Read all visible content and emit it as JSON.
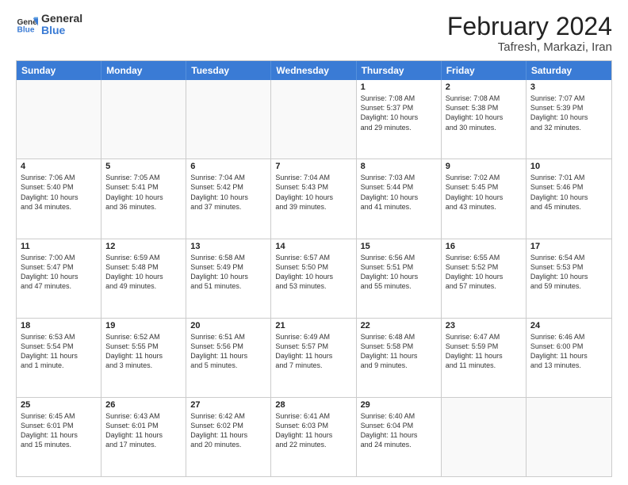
{
  "logo": {
    "line1": "General",
    "line2": "Blue"
  },
  "title": {
    "month_year": "February 2024",
    "location": "Tafresh, Markazi, Iran"
  },
  "header_days": [
    "Sunday",
    "Monday",
    "Tuesday",
    "Wednesday",
    "Thursday",
    "Friday",
    "Saturday"
  ],
  "rows": [
    [
      {
        "day": "",
        "info": ""
      },
      {
        "day": "",
        "info": ""
      },
      {
        "day": "",
        "info": ""
      },
      {
        "day": "",
        "info": ""
      },
      {
        "day": "1",
        "info": "Sunrise: 7:08 AM\nSunset: 5:37 PM\nDaylight: 10 hours\nand 29 minutes."
      },
      {
        "day": "2",
        "info": "Sunrise: 7:08 AM\nSunset: 5:38 PM\nDaylight: 10 hours\nand 30 minutes."
      },
      {
        "day": "3",
        "info": "Sunrise: 7:07 AM\nSunset: 5:39 PM\nDaylight: 10 hours\nand 32 minutes."
      }
    ],
    [
      {
        "day": "4",
        "info": "Sunrise: 7:06 AM\nSunset: 5:40 PM\nDaylight: 10 hours\nand 34 minutes."
      },
      {
        "day": "5",
        "info": "Sunrise: 7:05 AM\nSunset: 5:41 PM\nDaylight: 10 hours\nand 36 minutes."
      },
      {
        "day": "6",
        "info": "Sunrise: 7:04 AM\nSunset: 5:42 PM\nDaylight: 10 hours\nand 37 minutes."
      },
      {
        "day": "7",
        "info": "Sunrise: 7:04 AM\nSunset: 5:43 PM\nDaylight: 10 hours\nand 39 minutes."
      },
      {
        "day": "8",
        "info": "Sunrise: 7:03 AM\nSunset: 5:44 PM\nDaylight: 10 hours\nand 41 minutes."
      },
      {
        "day": "9",
        "info": "Sunrise: 7:02 AM\nSunset: 5:45 PM\nDaylight: 10 hours\nand 43 minutes."
      },
      {
        "day": "10",
        "info": "Sunrise: 7:01 AM\nSunset: 5:46 PM\nDaylight: 10 hours\nand 45 minutes."
      }
    ],
    [
      {
        "day": "11",
        "info": "Sunrise: 7:00 AM\nSunset: 5:47 PM\nDaylight: 10 hours\nand 47 minutes."
      },
      {
        "day": "12",
        "info": "Sunrise: 6:59 AM\nSunset: 5:48 PM\nDaylight: 10 hours\nand 49 minutes."
      },
      {
        "day": "13",
        "info": "Sunrise: 6:58 AM\nSunset: 5:49 PM\nDaylight: 10 hours\nand 51 minutes."
      },
      {
        "day": "14",
        "info": "Sunrise: 6:57 AM\nSunset: 5:50 PM\nDaylight: 10 hours\nand 53 minutes."
      },
      {
        "day": "15",
        "info": "Sunrise: 6:56 AM\nSunset: 5:51 PM\nDaylight: 10 hours\nand 55 minutes."
      },
      {
        "day": "16",
        "info": "Sunrise: 6:55 AM\nSunset: 5:52 PM\nDaylight: 10 hours\nand 57 minutes."
      },
      {
        "day": "17",
        "info": "Sunrise: 6:54 AM\nSunset: 5:53 PM\nDaylight: 10 hours\nand 59 minutes."
      }
    ],
    [
      {
        "day": "18",
        "info": "Sunrise: 6:53 AM\nSunset: 5:54 PM\nDaylight: 11 hours\nand 1 minute."
      },
      {
        "day": "19",
        "info": "Sunrise: 6:52 AM\nSunset: 5:55 PM\nDaylight: 11 hours\nand 3 minutes."
      },
      {
        "day": "20",
        "info": "Sunrise: 6:51 AM\nSunset: 5:56 PM\nDaylight: 11 hours\nand 5 minutes."
      },
      {
        "day": "21",
        "info": "Sunrise: 6:49 AM\nSunset: 5:57 PM\nDaylight: 11 hours\nand 7 minutes."
      },
      {
        "day": "22",
        "info": "Sunrise: 6:48 AM\nSunset: 5:58 PM\nDaylight: 11 hours\nand 9 minutes."
      },
      {
        "day": "23",
        "info": "Sunrise: 6:47 AM\nSunset: 5:59 PM\nDaylight: 11 hours\nand 11 minutes."
      },
      {
        "day": "24",
        "info": "Sunrise: 6:46 AM\nSunset: 6:00 PM\nDaylight: 11 hours\nand 13 minutes."
      }
    ],
    [
      {
        "day": "25",
        "info": "Sunrise: 6:45 AM\nSunset: 6:01 PM\nDaylight: 11 hours\nand 15 minutes."
      },
      {
        "day": "26",
        "info": "Sunrise: 6:43 AM\nSunset: 6:01 PM\nDaylight: 11 hours\nand 17 minutes."
      },
      {
        "day": "27",
        "info": "Sunrise: 6:42 AM\nSunset: 6:02 PM\nDaylight: 11 hours\nand 20 minutes."
      },
      {
        "day": "28",
        "info": "Sunrise: 6:41 AM\nSunset: 6:03 PM\nDaylight: 11 hours\nand 22 minutes."
      },
      {
        "day": "29",
        "info": "Sunrise: 6:40 AM\nSunset: 6:04 PM\nDaylight: 11 hours\nand 24 minutes."
      },
      {
        "day": "",
        "info": ""
      },
      {
        "day": "",
        "info": ""
      }
    ]
  ]
}
